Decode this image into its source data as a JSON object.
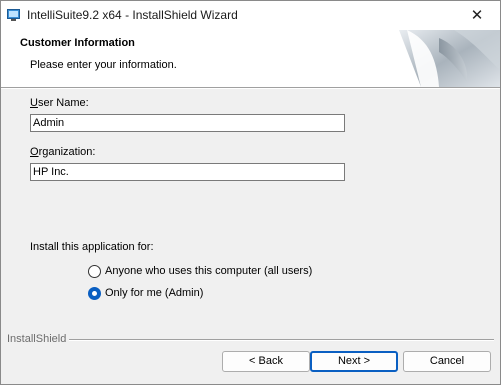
{
  "window": {
    "title": "IntelliSuite9.2 x64 - InstallShield Wizard",
    "close_glyph": "✕"
  },
  "header": {
    "title": "Customer Information",
    "subtitle": "Please enter your information."
  },
  "form": {
    "user_name_label_accel": "U",
    "user_name_label_rest": "ser Name:",
    "user_name_value": "Admin",
    "organization_label_accel": "O",
    "organization_label_rest": "rganization:",
    "organization_value": "HP Inc."
  },
  "install_for": {
    "label": "Install this application for:",
    "options": [
      {
        "label": "Anyone who uses this computer (all users)",
        "selected": false
      },
      {
        "label": "Only for me (Admin)",
        "selected": true
      }
    ]
  },
  "footer": {
    "brand": "InstallShield",
    "back_label": "< Back",
    "next_label": "Next >",
    "cancel_label": "Cancel"
  },
  "colors": {
    "accent": "#0a5fc2"
  }
}
